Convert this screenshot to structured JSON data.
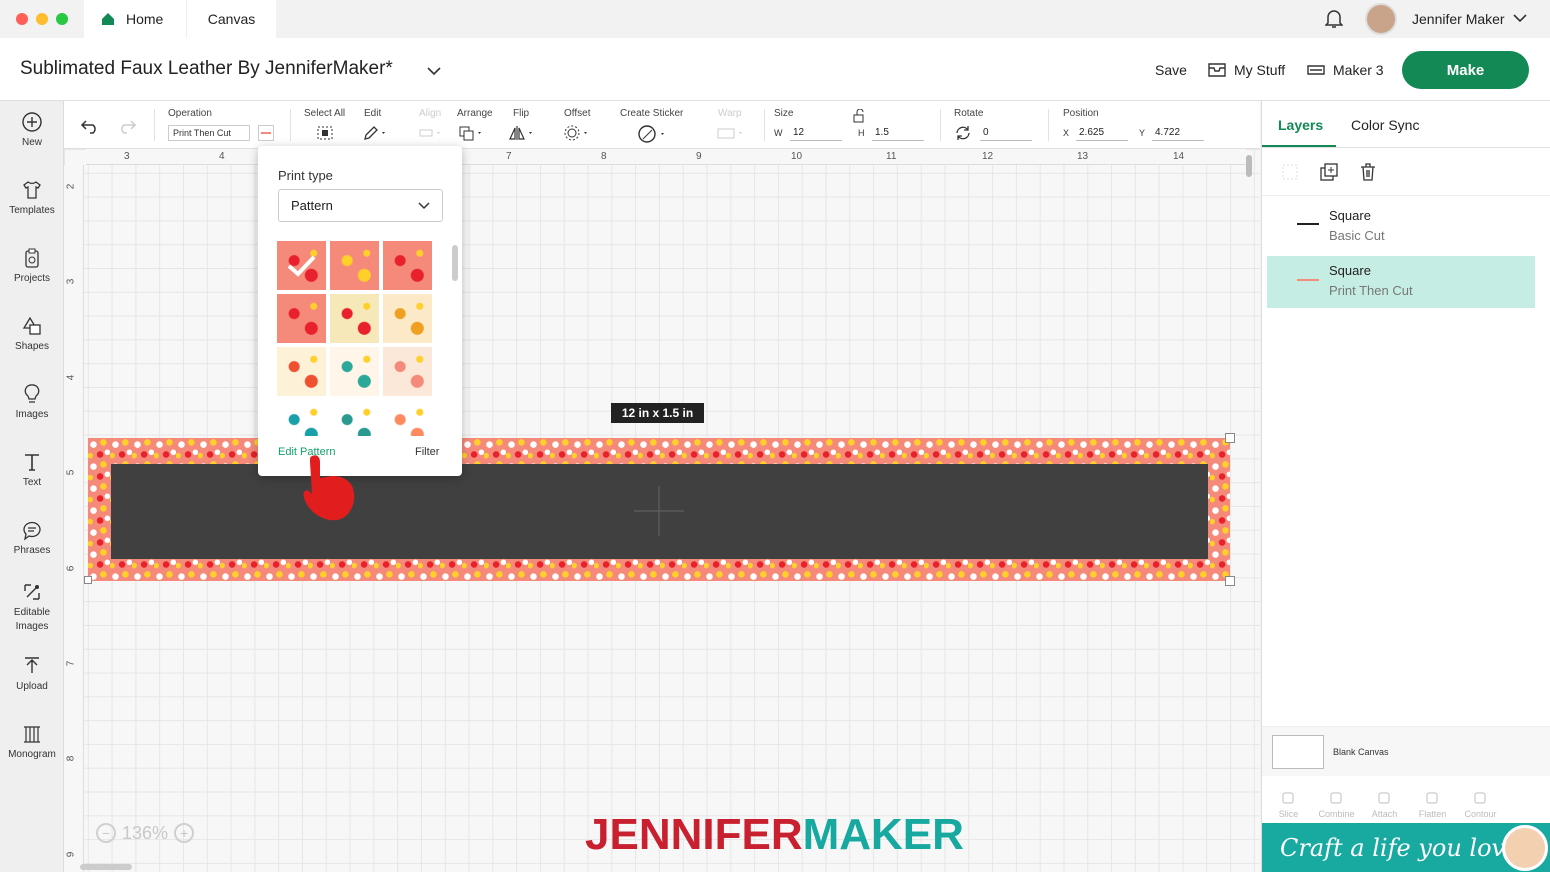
{
  "tabs": {
    "home": "Home",
    "canvas": "Canvas"
  },
  "user": {
    "name": "Jennifer Maker"
  },
  "header": {
    "title": "Sublimated Faux Leather By JenniferMaker*",
    "save": "Save",
    "my_stuff": "My Stuff",
    "machine": "Maker 3",
    "make": "Make"
  },
  "sidebar": {
    "items": [
      {
        "label": "New",
        "icon": "plus-circle-icon"
      },
      {
        "label": "Templates",
        "icon": "shirt-icon"
      },
      {
        "label": "Projects",
        "icon": "clipboard-icon"
      },
      {
        "label": "Shapes",
        "icon": "shapes-icon"
      },
      {
        "label": "Images",
        "icon": "bulb-icon"
      },
      {
        "label": "Text",
        "icon": "text-icon"
      },
      {
        "label": "Phrases",
        "icon": "speech-bubble-icon"
      },
      {
        "label": "Editable Images",
        "icon": "editable-images-icon"
      },
      {
        "label": "Upload",
        "icon": "upload-icon"
      },
      {
        "label": "Monogram",
        "icon": "monogram-icon"
      }
    ]
  },
  "toolbar": {
    "operation_label": "Operation",
    "operation_value": "Print Then Cut",
    "select_all": "Select All",
    "edit": "Edit",
    "align": "Align",
    "arrange": "Arrange",
    "flip": "Flip",
    "offset": "Offset",
    "create_sticker": "Create Sticker",
    "warp": "Warp",
    "size_label": "Size",
    "w_label": "W",
    "w_value": "12",
    "h_label": "H",
    "h_value": "1.5",
    "rotate_label": "Rotate",
    "rotate_value": "0",
    "position_label": "Position",
    "x_label": "X",
    "x_value": "2.625",
    "y_label": "Y",
    "y_value": "4.722"
  },
  "ruler": {
    "top": [
      "3",
      "4",
      "7",
      "8",
      "9",
      "10",
      "11",
      "12",
      "13",
      "14"
    ],
    "left": [
      "2",
      "3",
      "4",
      "5",
      "6",
      "7",
      "8",
      "9"
    ]
  },
  "canvas": {
    "dimension_tooltip": "12  in x 1.5  in",
    "zoom": "136%"
  },
  "popup": {
    "print_type_label": "Print type",
    "print_type_value": "Pattern",
    "edit_pattern": "Edit Pattern",
    "filter": "Filter",
    "swatch_colors": [
      "#f58a7b",
      "#f58a7b",
      "#f58a7b",
      "#f58a7b",
      "#f6e8b8",
      "#fbe9c8",
      "#fdf1d8",
      "#fff5e8",
      "#fbe8d8",
      "#ffffff",
      "#ffffff",
      "#ffffff"
    ]
  },
  "panel": {
    "tab_layers": "Layers",
    "tab_color_sync": "Color Sync",
    "layers": [
      {
        "name": "Square",
        "sub": "Basic Cut"
      },
      {
        "name": "Square",
        "sub": "Print Then Cut"
      }
    ],
    "blank_canvas": "Blank Canvas",
    "tools": [
      "Slice",
      "Combine",
      "Attach",
      "Flatten",
      "Contour"
    ],
    "banner": "Craft a life you love"
  },
  "brand": {
    "part1": "JENNIFER",
    "part2": "MAKER",
    "color1": "#c8202f",
    "color2": "#17a99f"
  },
  "colors": {
    "make": "#138a55",
    "accent": "#14a06a"
  }
}
